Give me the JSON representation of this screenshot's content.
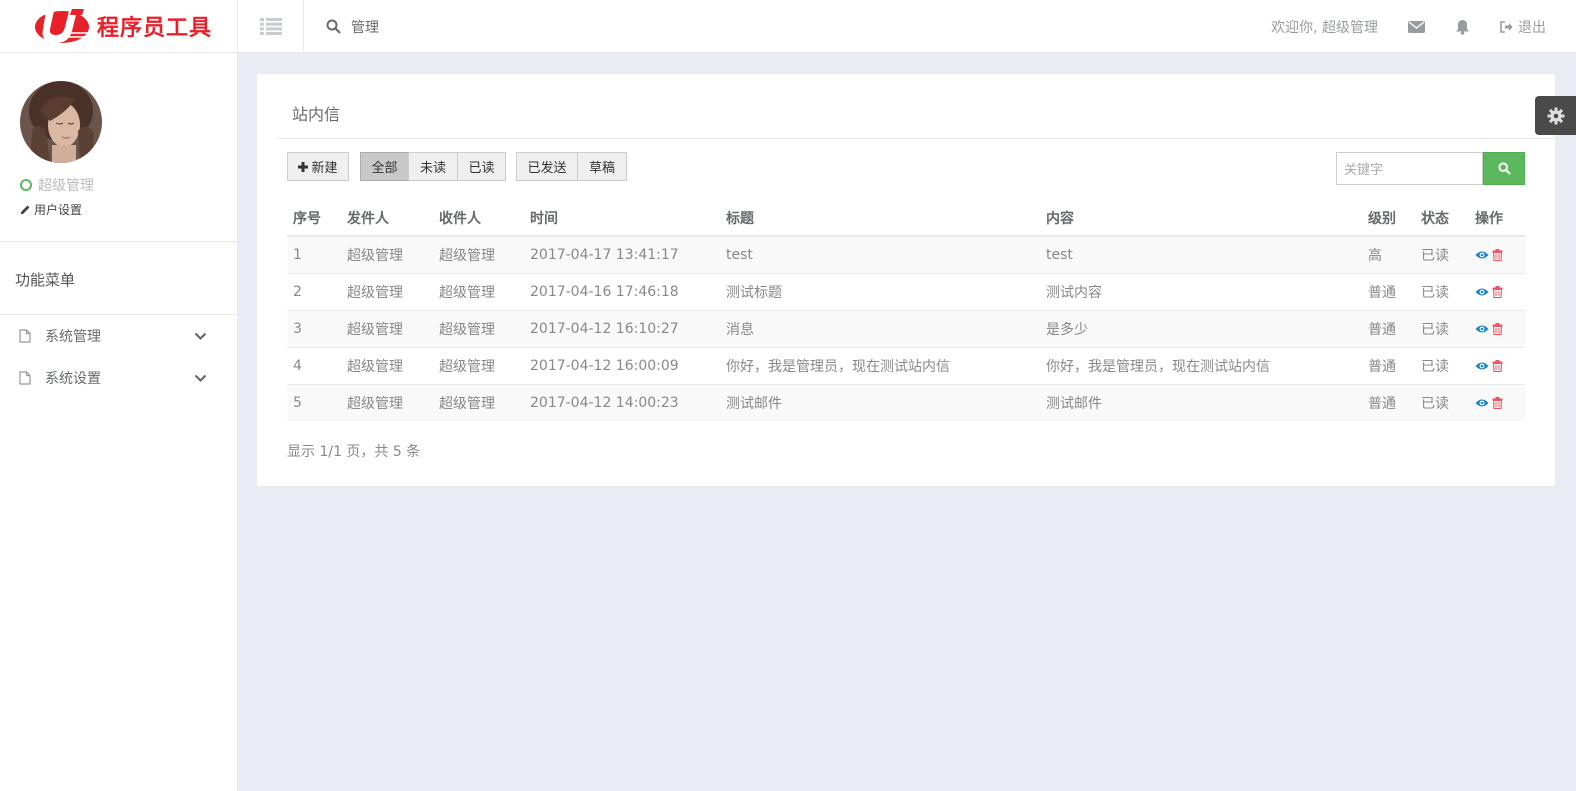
{
  "header": {
    "logo_text": "程序员工具",
    "search_label": "管理",
    "welcome": "欢迎你, 超级管理",
    "logout": "退出"
  },
  "sidebar": {
    "user_name": "超级管理",
    "user_settings": "用户设置",
    "menu_title": "功能菜单",
    "items": [
      {
        "label": "系统管理"
      },
      {
        "label": "系统设置"
      }
    ]
  },
  "main": {
    "title": "站内信",
    "buttons": {
      "new": "新建",
      "all": "全部",
      "unread": "未读",
      "read": "已读",
      "sent": "已发送",
      "draft": "草稿"
    },
    "search_placeholder": "关键字",
    "table": {
      "headers": [
        "序号",
        "发件人",
        "收件人",
        "时间",
        "标题",
        "内容",
        "级别",
        "状态",
        "操作"
      ],
      "rows": [
        [
          "1",
          "超级管理",
          "超级管理",
          "2017-04-17 13:41:17",
          "test",
          "test",
          "高",
          "已读"
        ],
        [
          "2",
          "超级管理",
          "超级管理",
          "2017-04-16 17:46:18",
          "测试标题",
          "测试内容",
          "普通",
          "已读"
        ],
        [
          "3",
          "超级管理",
          "超级管理",
          "2017-04-12 16:10:27",
          "消息",
          "是多少",
          "普通",
          "已读"
        ],
        [
          "4",
          "超级管理",
          "超级管理",
          "2017-04-12 16:00:09",
          "你好，我是管理员，现在测试站内信",
          "你好，我是管理员，现在测试站内信",
          "普通",
          "已读"
        ],
        [
          "5",
          "超级管理",
          "超级管理",
          "2017-04-12 14:00:23",
          "测试邮件",
          "测试邮件",
          "普通",
          "已读"
        ]
      ]
    },
    "page_info": "显示 1/1 页，共 5 条"
  },
  "colors": {
    "brand": "#e8202a",
    "success": "#5cb85c",
    "view": "#1c84c6",
    "delete": "#ed5565"
  }
}
